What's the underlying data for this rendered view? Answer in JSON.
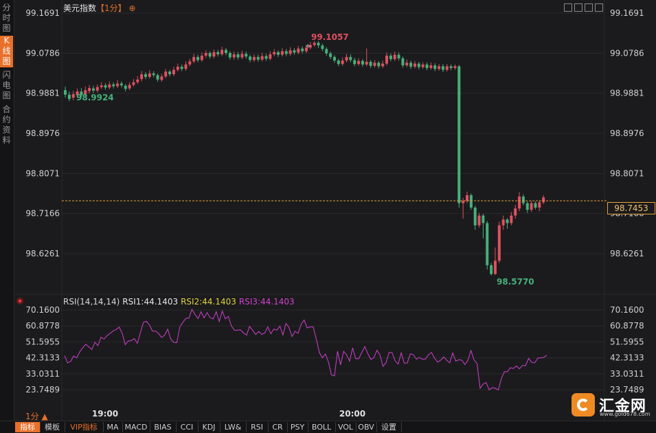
{
  "header": {
    "title": "美元指数",
    "period": "【1分】",
    "target_glyph": "⊕"
  },
  "left_rail": {
    "tabs": [
      {
        "label": "分时图",
        "active": false
      },
      {
        "label": "K线图",
        "active": true
      },
      {
        "label": "闪电图",
        "active": false
      },
      {
        "label": "合约资料",
        "active": false
      }
    ]
  },
  "colors": {
    "up": "#e05060",
    "down": "#45b07a",
    "rsi1": "#e6e6e6",
    "rsi2": "#e0d040",
    "rsi3": "#d040d0",
    "accent": "#e8702a",
    "current_price_line": "#e8a33a"
  },
  "price_axis": {
    "ticks": [
      "99.1691",
      "99.0786",
      "98.9881",
      "98.8976",
      "98.8071",
      "98.7166",
      "98.6261"
    ],
    "current_price": "98.7453"
  },
  "annotations": {
    "high": "99.1057",
    "low_left": "98.9924",
    "low": "98.5770"
  },
  "rsi": {
    "header_prefix": "RSI(14,14,14)",
    "rsi1_label": "RSI1:44.1403",
    "rsi2_label": "RSI2:44.1403",
    "rsi3_label": "RSI3:44.1403",
    "ticks": [
      "70.1600",
      "60.8778",
      "51.5955",
      "42.3133",
      "33.0311",
      "23.7489"
    ]
  },
  "time_axis": {
    "labels": [
      "19:00",
      "20:00"
    ]
  },
  "bottom_bar": {
    "period_label": "1分 ▲",
    "tabs": [
      "指标",
      "模板",
      "VIP指标",
      "MA",
      "MACD",
      "BIAS",
      "CCI",
      "KDJ",
      "LW&",
      "RSI",
      "CR",
      "PSY",
      "BOLL",
      "VOL",
      "OBV",
      "设置"
    ],
    "active_tab": "指标",
    "vip_tab": "VIP指标"
  },
  "logo": {
    "text": "汇金网",
    "url": "www.gold678.com"
  },
  "chart_data": [
    {
      "type": "candlestick",
      "title": "美元指数",
      "ylim": [
        98.57,
        99.17
      ],
      "x_labels": [
        "19:00",
        "20:00"
      ],
      "candles": [
        [
          98.995,
          98.985,
          99.003,
          98.978
        ],
        [
          98.985,
          98.975,
          98.992,
          98.97
        ],
        [
          98.978,
          98.986,
          98.993,
          98.972
        ],
        [
          98.984,
          98.992,
          98.999,
          98.978
        ],
        [
          98.992,
          98.984,
          99.0,
          98.979
        ],
        [
          98.986,
          98.995,
          99.003,
          98.982
        ],
        [
          98.993,
          99.0,
          99.007,
          98.988
        ],
        [
          98.999,
          98.994,
          99.005,
          98.989
        ],
        [
          98.994,
          99.002,
          99.008,
          98.99
        ],
        [
          99.002,
          99.006,
          99.013,
          98.998
        ],
        [
          99.006,
          99.001,
          99.011,
          98.996
        ],
        [
          99.001,
          99.008,
          99.015,
          98.997
        ],
        [
          99.008,
          99.004,
          99.013,
          98.999
        ],
        [
          99.004,
          99.01,
          99.018,
          99.0
        ],
        [
          99.01,
          99.006,
          99.015,
          99.001
        ],
        [
          99.005,
          98.998,
          99.009,
          98.992
        ],
        [
          98.999,
          99.007,
          99.013,
          98.995
        ],
        [
          99.007,
          99.013,
          99.02,
          99.003
        ],
        [
          99.013,
          99.019,
          99.027,
          99.009
        ],
        [
          99.02,
          99.031,
          99.038,
          99.015
        ],
        [
          99.031,
          99.025,
          99.036,
          99.02
        ],
        [
          99.025,
          99.033,
          99.04,
          99.021
        ],
        [
          99.033,
          99.029,
          99.038,
          99.024
        ],
        [
          99.029,
          99.019,
          99.033,
          99.014
        ],
        [
          99.018,
          99.026,
          99.032,
          99.014
        ],
        [
          99.026,
          99.037,
          99.043,
          99.022
        ],
        [
          99.037,
          99.031,
          99.041,
          99.026
        ],
        [
          99.031,
          99.041,
          99.048,
          99.027
        ],
        [
          99.041,
          99.048,
          99.055,
          99.037
        ],
        [
          99.048,
          99.043,
          99.053,
          99.038
        ],
        [
          99.043,
          99.053,
          99.06,
          99.039
        ],
        [
          99.053,
          99.06,
          99.066,
          99.049
        ],
        [
          99.06,
          99.07,
          99.077,
          99.056
        ],
        [
          99.07,
          99.063,
          99.075,
          99.058
        ],
        [
          99.063,
          99.073,
          99.08,
          99.059
        ],
        [
          99.073,
          99.079,
          99.085,
          99.068
        ],
        [
          99.079,
          99.071,
          99.083,
          99.066
        ],
        [
          99.071,
          99.081,
          99.087,
          99.067
        ],
        [
          99.081,
          99.076,
          99.086,
          99.071
        ],
        [
          99.076,
          99.086,
          99.093,
          99.072
        ],
        [
          99.086,
          99.079,
          99.09,
          99.074
        ],
        [
          99.079,
          99.069,
          99.083,
          99.064
        ],
        [
          99.069,
          99.076,
          99.082,
          99.064
        ],
        [
          99.076,
          99.069,
          99.081,
          99.064
        ],
        [
          99.069,
          99.077,
          99.084,
          99.065
        ],
        [
          99.077,
          99.071,
          99.082,
          99.066
        ],
        [
          99.071,
          99.063,
          99.075,
          99.058
        ],
        [
          99.063,
          99.07,
          99.076,
          99.059
        ],
        [
          99.07,
          99.064,
          99.075,
          99.059
        ],
        [
          99.064,
          99.072,
          99.079,
          99.06
        ],
        [
          99.072,
          99.066,
          99.077,
          99.061
        ],
        [
          99.066,
          99.076,
          99.083,
          99.062
        ],
        [
          99.076,
          99.081,
          99.088,
          99.072
        ],
        [
          99.081,
          99.075,
          99.085,
          99.07
        ],
        [
          99.075,
          99.083,
          99.09,
          99.071
        ],
        [
          99.083,
          99.077,
          99.088,
          99.072
        ],
        [
          99.077,
          99.085,
          99.092,
          99.073
        ],
        [
          99.085,
          99.08,
          99.09,
          99.075
        ],
        [
          99.08,
          99.089,
          99.095,
          99.076
        ],
        [
          99.089,
          99.083,
          99.094,
          99.078
        ],
        [
          99.083,
          99.091,
          99.097,
          99.079
        ],
        [
          99.091,
          99.097,
          99.104,
          99.087
        ],
        [
          99.097,
          99.102,
          99.106,
          99.093
        ],
        [
          99.102,
          99.096,
          99.106,
          99.09
        ],
        [
          99.096,
          99.088,
          99.1,
          99.083
        ],
        [
          99.088,
          99.078,
          99.092,
          99.073
        ],
        [
          99.078,
          99.07,
          99.082,
          99.065
        ],
        [
          99.07,
          99.062,
          99.074,
          99.057
        ],
        [
          99.062,
          99.054,
          99.066,
          99.049
        ],
        [
          99.054,
          99.062,
          99.069,
          99.05
        ],
        [
          99.062,
          99.07,
          99.077,
          99.058
        ],
        [
          99.07,
          99.063,
          99.076,
          99.058
        ],
        [
          99.063,
          99.054,
          99.068,
          99.049
        ],
        [
          99.054,
          99.061,
          99.067,
          99.05
        ],
        [
          99.061,
          99.053,
          99.065,
          99.048
        ],
        [
          99.053,
          99.059,
          99.089,
          99.049
        ],
        [
          99.059,
          99.05,
          99.063,
          99.045
        ],
        [
          99.05,
          99.057,
          99.063,
          99.046
        ],
        [
          99.057,
          99.049,
          99.061,
          99.044
        ],
        [
          99.049,
          99.055,
          99.062,
          99.045
        ],
        [
          99.055,
          99.073,
          99.08,
          99.051
        ],
        [
          99.073,
          99.065,
          99.078,
          99.06
        ],
        [
          99.065,
          99.075,
          99.082,
          99.061
        ],
        [
          99.075,
          99.067,
          99.08,
          99.062
        ],
        [
          99.067,
          99.051,
          99.071,
          99.046
        ],
        [
          99.051,
          99.057,
          99.064,
          99.047
        ],
        [
          99.057,
          99.048,
          99.062,
          99.043
        ],
        [
          99.048,
          99.055,
          99.061,
          99.044
        ],
        [
          99.055,
          99.047,
          99.059,
          99.042
        ],
        [
          99.047,
          99.053,
          99.058,
          99.043
        ],
        [
          99.053,
          99.045,
          99.058,
          99.04
        ],
        [
          99.045,
          99.051,
          99.057,
          99.041
        ],
        [
          99.051,
          99.043,
          99.056,
          99.038
        ],
        [
          99.043,
          99.049,
          99.054,
          99.039
        ],
        [
          99.049,
          99.041,
          99.054,
          99.036
        ],
        [
          99.041,
          99.049,
          99.054,
          99.037
        ],
        [
          99.049,
          99.045,
          99.053,
          99.04
        ],
        [
          99.045,
          99.049,
          99.053,
          99.041
        ],
        [
          99.049,
          98.74,
          99.052,
          98.73
        ],
        [
          98.74,
          98.745,
          98.752,
          98.705
        ],
        [
          98.745,
          98.758,
          98.766,
          98.74
        ],
        [
          98.758,
          98.73,
          98.762,
          98.725
        ],
        [
          98.73,
          98.69,
          98.734,
          98.68
        ],
        [
          98.69,
          98.712,
          98.718,
          98.685
        ],
        [
          98.712,
          98.695,
          98.716,
          98.66
        ],
        [
          98.695,
          98.6,
          98.7,
          98.59
        ],
        [
          98.6,
          98.58,
          98.605,
          98.577
        ],
        [
          98.58,
          98.61,
          98.64,
          98.578
        ],
        [
          98.61,
          98.69,
          98.698,
          98.605
        ],
        [
          98.69,
          98.703,
          98.712,
          98.68
        ],
        [
          98.703,
          98.695,
          98.706,
          98.682
        ],
        [
          98.695,
          98.712,
          98.72,
          98.69
        ],
        [
          98.712,
          98.728,
          98.736,
          98.705
        ],
        [
          98.728,
          98.755,
          98.765,
          98.722
        ],
        [
          98.755,
          98.74,
          98.76,
          98.735
        ],
        [
          98.74,
          98.725,
          98.744,
          98.718
        ],
        [
          98.725,
          98.74,
          98.745,
          98.72
        ],
        [
          98.74,
          98.73,
          98.744,
          98.726
        ],
        [
          98.73,
          98.742,
          98.746,
          98.722
        ],
        [
          98.742,
          98.753,
          98.758,
          98.738
        ]
      ]
    },
    {
      "type": "line",
      "title": "RSI(14,14,14)",
      "ylim": [
        23.7489,
        70.16
      ],
      "series": [
        {
          "name": "RSI1",
          "values": [
            43.5,
            39.4,
            40.2,
            43.3,
            42.3,
            45.8,
            48.2,
            50.2,
            48.7,
            47.2,
            51.4,
            49.4,
            54.3,
            53.2,
            55.2,
            56.5,
            57.9,
            58.8,
            60.2,
            56.6,
            50.0,
            52.1,
            52.3,
            53.5,
            50.7,
            57.0,
            62.9,
            63.6,
            61.4,
            57.8,
            57.9,
            56.4,
            54.1,
            55.5,
            59.0,
            53.3,
            51.3,
            51.1,
            60.4,
            62.9,
            65.3,
            65.4,
            70.5,
            67.6,
            65.1,
            69.1,
            65.5,
            68.6,
            65.7,
            64.9,
            69.1,
            63.5,
            69.5,
            65.0,
            66.4,
            60.9,
            58.4,
            58.4,
            58.6,
            56.8,
            55.5,
            60.6,
            58.4,
            55.9,
            57.6,
            56.0,
            56.7,
            60.3,
            56.3,
            59.0,
            58.4,
            60.7,
            55.6,
            62.3,
            59.9,
            54.7,
            57.7,
            56.6,
            61.8,
            64.3,
            59.7,
            60.3,
            60.3,
            53.1,
            45.4,
            42.3,
            44.5,
            39.9,
            32.3,
            31.8,
            46.1,
            38.2,
            46.1,
            44.0,
            40.4,
            48.1,
            41.8,
            41.8,
            45.4,
            48.9,
            44.7,
            41.4,
            42.4,
            46.7,
            43.9,
            37.3,
            39.5,
            45.4,
            45.3,
            40.6,
            38.6,
            45.2,
            39.2,
            39.3,
            44.6,
            44.2,
            41.5,
            42.5,
            41.4,
            41.6,
            44.1,
            45.4,
            42.1,
            39.8,
            40.9,
            42.8,
            40.9,
            39.4,
            45.1,
            40.4,
            41.2,
            40.9,
            38.4,
            40.8,
            46.6,
            41.2,
            39.0,
            24.6,
            27.0,
            27.9,
            23.7,
            24.9,
            24.6,
            23.6,
            30.1,
            34.2,
            34.2,
            36.5,
            36.1,
            37.6,
            35.9,
            37.9,
            37.7,
            42.0,
            39.7,
            39.3,
            42.1,
            42.3,
            42.5,
            43.9
          ]
        }
      ]
    }
  ]
}
